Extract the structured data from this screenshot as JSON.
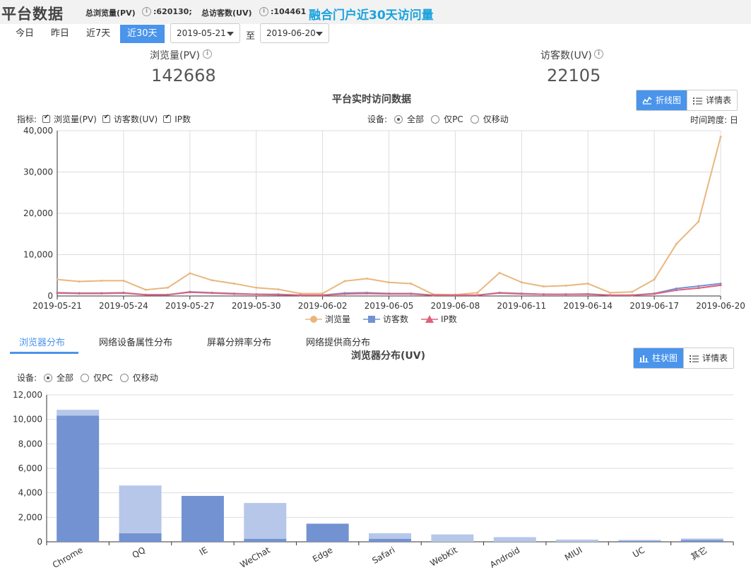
{
  "header": {
    "title": "平台数据",
    "pv_label": "总浏览量(PV)",
    "pv_value": ":620130;",
    "uv_label": "总访客数(UV)",
    "uv_value": ":104461",
    "headline": "融合门户近30天访问量",
    "info_glyph": "i"
  },
  "date_range": {
    "buttons": [
      "今日",
      "昨日",
      "近7天",
      "近30天"
    ],
    "active": "近30天",
    "start": "2019-05-21",
    "to": "至",
    "end": "2019-06-20"
  },
  "summary": {
    "pv_label": "浏览量(PV)",
    "pv_value": "142668",
    "uv_label": "访客数(UV)",
    "uv_value": "22105"
  },
  "realtime": {
    "title": "平台实时访问数据",
    "line_btn": "折线图",
    "detail_btn": "详情表",
    "metric_label": "指标:",
    "metrics": [
      "浏览量(PV)",
      "访客数(UV)",
      "IP数"
    ],
    "device_label": "设备:",
    "devices": [
      "全部",
      "仅PC",
      "仅移动"
    ],
    "span_label": "时间跨度: 日"
  },
  "tabs": [
    "浏览器分布",
    "网络设备属性分布",
    "屏幕分辨率分布",
    "网络提供商分布"
  ],
  "browser": {
    "title": "浏览器分布(UV)",
    "bar_btn": "柱状图",
    "detail_btn": "详情表",
    "device_label": "设备:",
    "devices": [
      "全部",
      "仅PC",
      "仅移动"
    ]
  },
  "chart_data": [
    {
      "type": "line",
      "title": "平台实时访问数据",
      "x": [
        "2019-05-21",
        "2019-05-22",
        "2019-05-23",
        "2019-05-24",
        "2019-05-25",
        "2019-05-26",
        "2019-05-27",
        "2019-05-28",
        "2019-05-29",
        "2019-05-30",
        "2019-05-31",
        "2019-06-01",
        "2019-06-02",
        "2019-06-03",
        "2019-06-04",
        "2019-06-05",
        "2019-06-06",
        "2019-06-07",
        "2019-06-08",
        "2019-06-09",
        "2019-06-10",
        "2019-06-11",
        "2019-06-12",
        "2019-06-13",
        "2019-06-14",
        "2019-06-15",
        "2019-06-16",
        "2019-06-17",
        "2019-06-18",
        "2019-06-19",
        "2019-06-20"
      ],
      "xticks": [
        "2019-05-21",
        "2019-05-24",
        "2019-05-27",
        "2019-05-30",
        "2019-06-02",
        "2019-06-05",
        "2019-06-08",
        "2019-06-11",
        "2019-06-14",
        "2019-06-17",
        "2019-06-20"
      ],
      "ylim": [
        0,
        40000
      ],
      "yticks": [
        "0",
        "10,000",
        "20,000",
        "30,000",
        "40,000"
      ],
      "grid": true,
      "legend_position": "bottom",
      "series": [
        {
          "name": "浏览量",
          "color": "#e8b77e",
          "marker": "circle",
          "values": [
            4000,
            3500,
            3700,
            3700,
            1500,
            2000,
            5500,
            3800,
            3000,
            2000,
            1600,
            600,
            600,
            3600,
            4200,
            3300,
            3000,
            400,
            300,
            800,
            5600,
            3300,
            2300,
            2500,
            3000,
            800,
            1000,
            4000,
            12600,
            18000,
            38500
          ]
        },
        {
          "name": "访客数",
          "color": "#7392d2",
          "marker": "square",
          "values": [
            800,
            700,
            700,
            800,
            300,
            300,
            1000,
            800,
            600,
            400,
            400,
            200,
            200,
            700,
            800,
            600,
            600,
            200,
            200,
            200,
            800,
            600,
            400,
            400,
            500,
            200,
            200,
            600,
            1800,
            2400,
            3000
          ]
        },
        {
          "name": "IP数",
          "color": "#e0607e",
          "marker": "triangle",
          "values": [
            700,
            600,
            600,
            700,
            300,
            300,
            900,
            700,
            500,
            400,
            300,
            200,
            200,
            500,
            600,
            500,
            500,
            200,
            200,
            200,
            700,
            500,
            400,
            400,
            400,
            200,
            200,
            500,
            1400,
            1900,
            2600
          ]
        }
      ]
    },
    {
      "type": "bar",
      "title": "浏览器分布(UV)",
      "categories": [
        "Chrome",
        "QQ",
        "IE",
        "WeChat",
        "Edge",
        "Safari",
        "WebKit",
        "Android",
        "MIUI",
        "UC",
        "其它"
      ],
      "ylim": [
        0,
        12000
      ],
      "yticks": [
        "0",
        "2,000",
        "4,000",
        "6,000",
        "8,000",
        "10,000",
        "12,000"
      ],
      "grid": true,
      "series": [
        {
          "name": "",
          "color": "#7392d2",
          "values": [
            10300,
            700,
            3750,
            250,
            1480,
            250,
            0,
            0,
            0,
            80,
            150
          ]
        },
        {
          "name": "",
          "color": "#b6c7e9",
          "values": [
            480,
            3900,
            0,
            2920,
            0,
            450,
            600,
            380,
            180,
            70,
            120
          ]
        }
      ]
    }
  ]
}
